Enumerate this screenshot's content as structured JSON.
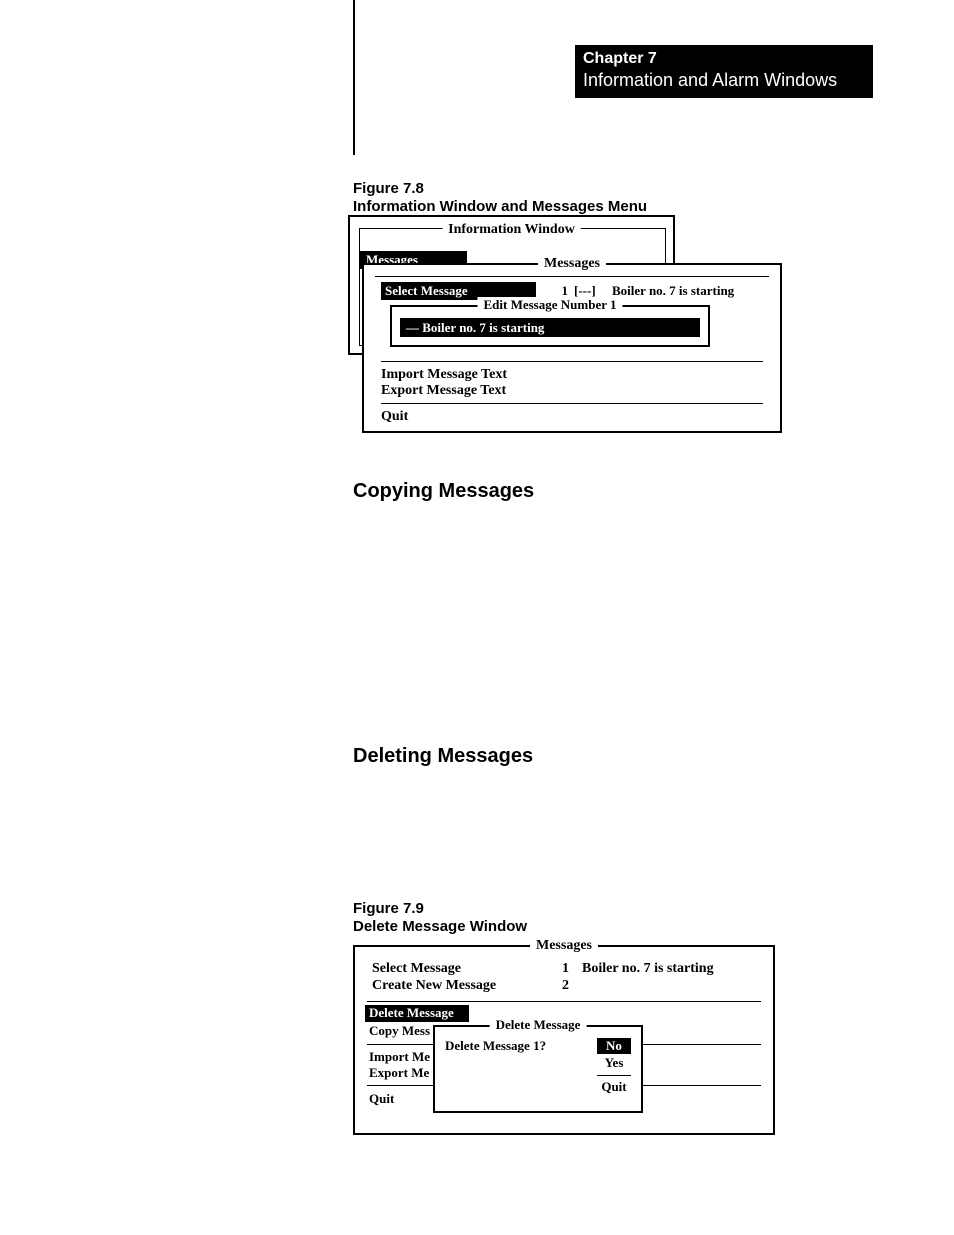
{
  "chapter": {
    "label": "Chapter 7",
    "title": "Information and Alarm Windows"
  },
  "fig78": {
    "caption_no": "Figure 7.8",
    "caption_title": "Information Window and Messages Menu",
    "info_window_title": "Information Window",
    "messages_label": "Messages",
    "messages_panel_title": "Messages",
    "select_message_label": "Select Message",
    "select_message_number": "1",
    "select_message_marker": "[---]",
    "select_message_text": "Boiler no. 7 is starting",
    "edit_box_title": "Edit Message Number 1",
    "edit_box_value": "— Boiler no. 7 is starting",
    "import_label": "Import Message Text",
    "export_label": "Export Message Text",
    "quit_label": "Quit"
  },
  "sections": {
    "copying": "Copying Messages",
    "deleting": "Deleting Messages"
  },
  "fig79": {
    "caption_no": "Figure 7.9",
    "caption_title": "Delete Message Window",
    "messages_panel_title": "Messages",
    "select_message_label": "Select Message",
    "select_message_number": "1",
    "select_message_text": "Boiler no. 7 is starting",
    "create_new_label": "Create New Message",
    "create_new_number": "2",
    "delete_message_label": "Delete Message",
    "copy_message_label": "Copy Mess",
    "import_label": "Import Me",
    "export_label": "Export Me",
    "quit_label": "Quit",
    "dialog": {
      "title": "Delete Message",
      "question": "Delete Message 1?",
      "no": "No",
      "yes": "Yes",
      "quit": "Quit"
    }
  }
}
